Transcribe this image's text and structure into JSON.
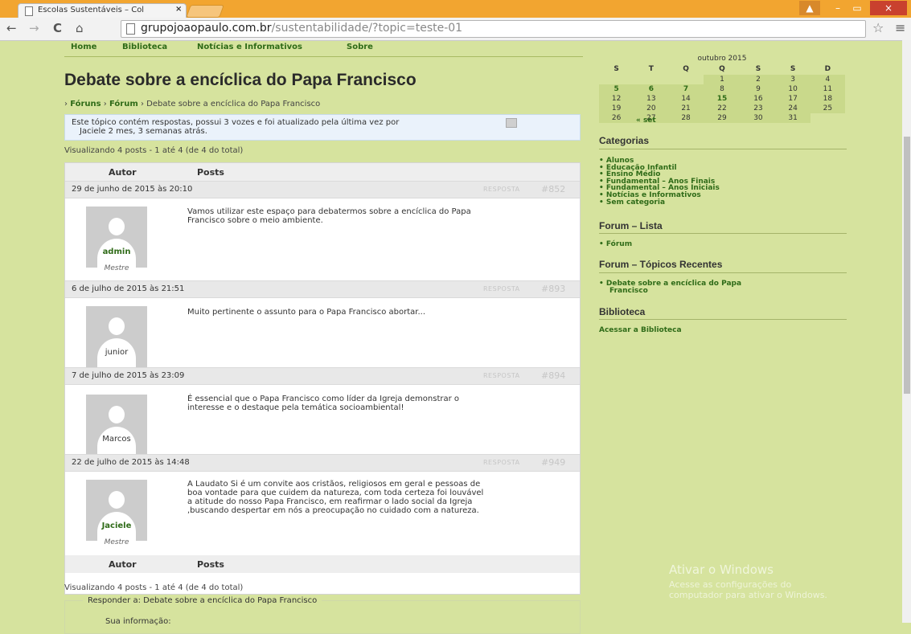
{
  "browser": {
    "tab_title": "Escolas Sustentáveis – Col",
    "tab_close": "×",
    "url_host": "grupojoaopaulo.com.br",
    "url_path": "/sustentabilidade/?topic=teste-01",
    "win_min": "–",
    "win_max": "▭",
    "win_close": "×",
    "user_badge": "▲"
  },
  "nav": {
    "items": [
      "Home",
      "Biblioteca",
      "Notícias e Informativos",
      "Sobre"
    ]
  },
  "topic": {
    "title": "Debate sobre a encíclica do Papa Francisco",
    "breadcrumb": {
      "sep": "›",
      "forums": "Fóruns",
      "forum": "Fórum",
      "current": "Debate sobre a encíclica do Papa Francisco"
    },
    "notice_line1": "Este tópico contém respostas, possui 3 vozes e foi atualizado pela última vez por",
    "notice_line2": "Jaciele 2 mes, 3 semanas atrás.",
    "viewing": "Visualizando 4 posts - 1 até 4 (de 4 do total)"
  },
  "table": {
    "author_header": "Autor",
    "posts_header": "Posts"
  },
  "posts": [
    {
      "date": "29 de junho de 2015 às 20:10",
      "reply": "RESPOSTA",
      "number": "#852",
      "author": "admin",
      "role": "Mestre",
      "content": [
        "Vamos utilizar este espaço para debatermos sobre a encíclica do Papa",
        "Francisco sobre o meio ambiente."
      ]
    },
    {
      "date": "6 de julho de 2015 às 21:51",
      "reply": "RESPOSTA",
      "number": "#893",
      "author": "junior",
      "role": "",
      "content": [
        "Muito pertinente o assunto para o Papa Francisco abortar..."
      ]
    },
    {
      "date": "7 de julho de 2015 às 23:09",
      "reply": "RESPOSTA",
      "number": "#894",
      "author": "Marcos",
      "role": "",
      "content": [
        "É essencial que o Papa Francisco como líder da Igreja demonstrar o",
        "interesse e o destaque pela temática socioambiental!"
      ]
    },
    {
      "date": "22 de julho de 2015 às 14:48",
      "reply": "RESPOSTA",
      "number": "#949",
      "author": "Jaciele",
      "role": "Mestre",
      "content": [
        "A Laudato Si é um convite aos cristãos, religiosos em geral e pessoas de",
        "boa vontade para que cuidem da natureza, com toda certeza foi louvável",
        "a atitude do nosso Papa Francisco, em reafirmar o lado social da Igreja",
        ",buscando despertar em nós a preocupação no cuidado com a natureza."
      ]
    }
  ],
  "reply_form": {
    "legend": "Responder a: Debate sobre a encíclica do Papa Francisco",
    "sub": "Sua informação:"
  },
  "calendar": {
    "caption": "outubro 2015",
    "weekdays": [
      "S",
      "T",
      "Q",
      "Q",
      "S",
      "S",
      "D"
    ],
    "weeks": [
      [
        "",
        "",
        "",
        "1",
        "2",
        "3",
        "4"
      ],
      [
        "5",
        "6",
        "7",
        "8",
        "9",
        "10",
        "11"
      ],
      [
        "12",
        "13",
        "14",
        "15",
        "16",
        "17",
        "18"
      ],
      [
        "19",
        "20",
        "21",
        "22",
        "23",
        "24",
        "25"
      ],
      [
        "26",
        "27",
        "28",
        "29",
        "30",
        "31",
        ""
      ]
    ],
    "linked_days": [
      "5",
      "6",
      "7",
      "15"
    ],
    "prev": "« set"
  },
  "sidebar": {
    "categories_title": "Categorias",
    "categories": [
      "Alunos",
      "Educação Infantil",
      "Ensino Médio",
      "Fundamental – Anos Finais",
      "Fundamental – Anos Iniciais",
      "Notícias e Informativos",
      "Sem categoria"
    ],
    "forum_list_title": "Forum – Lista",
    "forum_list": [
      "Fórum"
    ],
    "recent_title": "Forum – Tópicos Recentes",
    "recent": [
      "Debate sobre a encíclica do Papa",
      "Francisco"
    ],
    "library_title": "Biblioteca",
    "library_link": "Acessar a Biblioteca"
  },
  "watermark": {
    "title": "Ativar o Windows",
    "line1": "Acesse as configurações do",
    "line2": "computador para ativar o Windows."
  },
  "colors": {
    "page_bg": "#d6e39e",
    "link_green": "#2f6b18",
    "tab_orange": "#f2a530"
  }
}
